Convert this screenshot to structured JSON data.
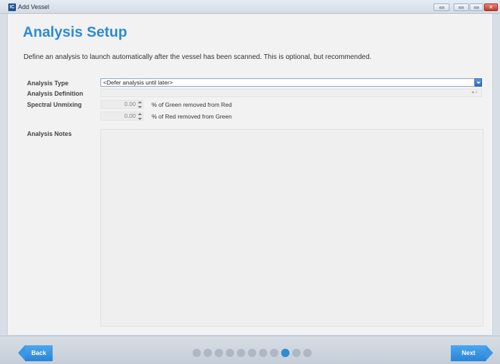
{
  "window": {
    "title": "Add Vessel",
    "icon_label": "IC"
  },
  "page": {
    "title": "Analysis Setup",
    "description": "Define an analysis to launch automatically after the vessel has been scanned.  This is optional, but recommended."
  },
  "form": {
    "analysis_type_label": "Analysis Type",
    "analysis_type_value": "<Defer analysis until later>",
    "analysis_definition_label": "Analysis Definition",
    "spectral_unmixing_label": "Spectral Unmixing",
    "green_from_red_value": "0.00",
    "green_from_red_caption": "% of Green removed from Red",
    "red_from_green_value": "0.00",
    "red_from_green_caption": "% of Red removed from Green",
    "analysis_notes_label": "Analysis Notes"
  },
  "footer": {
    "back_label": "Back",
    "next_label": "Next",
    "step_count": 11,
    "current_step": 9
  },
  "colors": {
    "accent": "#2b8bd6",
    "close": "#c0392b"
  },
  "icons": [
    "app-icon",
    "tray-icon",
    "minimize-icon",
    "maximize-icon",
    "close-icon",
    "dropdown-arrow-icon",
    "search-icon",
    "spin-up-icon",
    "spin-down-icon"
  ]
}
